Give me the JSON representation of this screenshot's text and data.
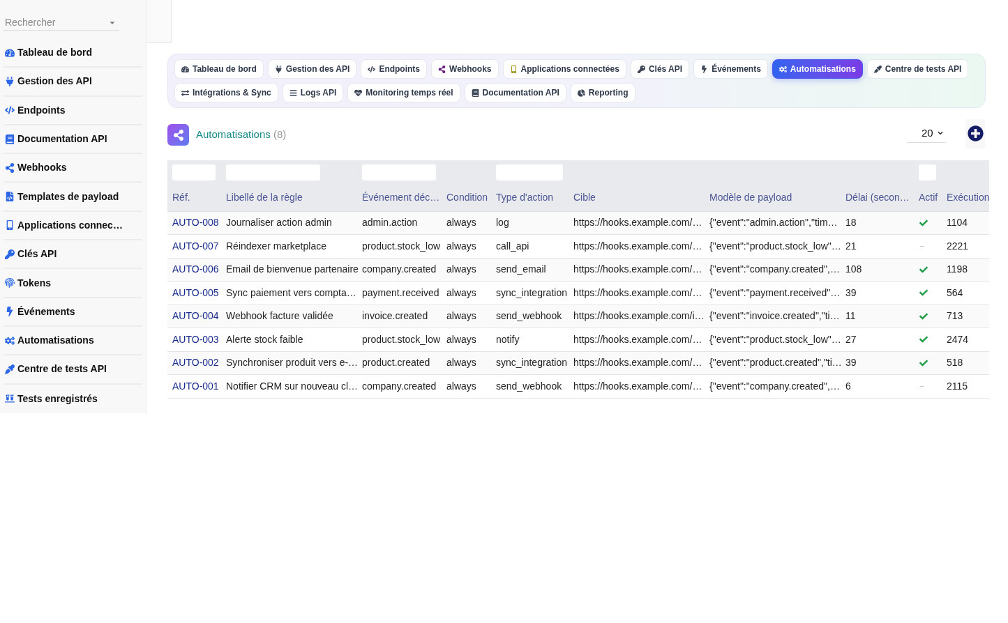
{
  "sidebar": {
    "search": {
      "placeholder": "Rechercher"
    },
    "items": [
      {
        "label": "Tableau de bord"
      },
      {
        "label": "Gestion des API"
      },
      {
        "label": "Endpoints"
      },
      {
        "label": "Documentation API"
      },
      {
        "label": "Webhooks"
      },
      {
        "label": "Templates de payload"
      },
      {
        "label": "Applications connec…"
      },
      {
        "label": "Clés API"
      },
      {
        "label": "Tokens"
      },
      {
        "label": "Événements"
      },
      {
        "label": "Automatisations"
      },
      {
        "label": "Centre de tests API"
      },
      {
        "label": "Tests enregistrés"
      }
    ]
  },
  "tabs": [
    {
      "label": "Tableau de bord",
      "selected": false
    },
    {
      "label": "Gestion des API",
      "selected": false
    },
    {
      "label": "Endpoints",
      "selected": false
    },
    {
      "label": "Webhooks",
      "selected": false
    },
    {
      "label": "Applications connectées",
      "selected": false
    },
    {
      "label": "Clés API",
      "selected": false
    },
    {
      "label": "Événements",
      "selected": false
    },
    {
      "label": "Automatisations",
      "selected": true
    },
    {
      "label": "Centre de tests API",
      "selected": false
    },
    {
      "label": "Intégrations & Sync",
      "selected": false
    },
    {
      "label": "Logs API",
      "selected": false
    },
    {
      "label": "Monitoring temps réel",
      "selected": false
    },
    {
      "label": "Documentation API",
      "selected": false
    },
    {
      "label": "Reporting",
      "selected": false
    }
  ],
  "section": {
    "title": "Automatisations",
    "count": "(8)",
    "page_size": "20"
  },
  "table": {
    "columns": [
      {
        "label": "Réf.",
        "filter": true
      },
      {
        "label": "Libellé de la règle",
        "filter": true
      },
      {
        "label": "Événement déc…",
        "filter": true
      },
      {
        "label": "Condition",
        "filter": false
      },
      {
        "label": "Type d'action",
        "filter": true
      },
      {
        "label": "Cible",
        "filter": false
      },
      {
        "label": "Modèle de payload",
        "filter": false
      },
      {
        "label": "Délai (secon…",
        "filter": false
      },
      {
        "label": "Actif",
        "filter": true
      },
      {
        "label": "Exécution",
        "filter": false
      }
    ],
    "rows": [
      {
        "ref": "AUTO-008",
        "name": "Journaliser action admin",
        "event": "admin.action",
        "condition": "always",
        "action_type": "log",
        "target": "https://hooks.example.com/…",
        "payload": "{\"event\":\"admin.action\",\"tim…",
        "delay": "18",
        "active": true,
        "executions": "1104"
      },
      {
        "ref": "AUTO-007",
        "name": "Réindexer marketplace",
        "event": "product.stock_low",
        "condition": "always",
        "action_type": "call_api",
        "target": "https://hooks.example.com/…",
        "payload": "{\"event\":\"product.stock_low\"…",
        "delay": "21",
        "active": false,
        "executions": "2221"
      },
      {
        "ref": "AUTO-006",
        "name": "Email de bienvenue partenaire",
        "event": "company.created",
        "condition": "always",
        "action_type": "send_email",
        "target": "https://hooks.example.com/…",
        "payload": "{\"event\":\"company.created\",…",
        "delay": "108",
        "active": true,
        "executions": "1198"
      },
      {
        "ref": "AUTO-005",
        "name": "Sync paiement vers compta…",
        "event": "payment.received",
        "condition": "always",
        "action_type": "sync_integration",
        "target": "https://hooks.example.com/…",
        "payload": "{\"event\":\"payment.received\"…",
        "delay": "39",
        "active": true,
        "executions": "564"
      },
      {
        "ref": "AUTO-004",
        "name": "Webhook facture validée",
        "event": "invoice.created",
        "condition": "always",
        "action_type": "send_webhook",
        "target": "https://hooks.example.com/i…",
        "payload": "{\"event\":\"invoice.created\",\"ti…",
        "delay": "11",
        "active": true,
        "executions": "713"
      },
      {
        "ref": "AUTO-003",
        "name": "Alerte stock faible",
        "event": "product.stock_low",
        "condition": "always",
        "action_type": "notify",
        "target": "https://hooks.example.com/…",
        "payload": "{\"event\":\"product.stock_low\"…",
        "delay": "27",
        "active": true,
        "executions": "2474"
      },
      {
        "ref": "AUTO-002",
        "name": "Synchroniser produit vers e-…",
        "event": "product.created",
        "condition": "always",
        "action_type": "sync_integration",
        "target": "https://hooks.example.com/…",
        "payload": "{\"event\":\"product.created\",\"ti…",
        "delay": "39",
        "active": true,
        "executions": "518"
      },
      {
        "ref": "AUTO-001",
        "name": "Notifier CRM sur nouveau cl…",
        "event": "company.created",
        "condition": "always",
        "action_type": "send_webhook",
        "target": "https://hooks.example.com/…",
        "payload": "{\"event\":\"company.created\",…",
        "delay": "6",
        "active": false,
        "executions": "2115"
      }
    ]
  }
}
